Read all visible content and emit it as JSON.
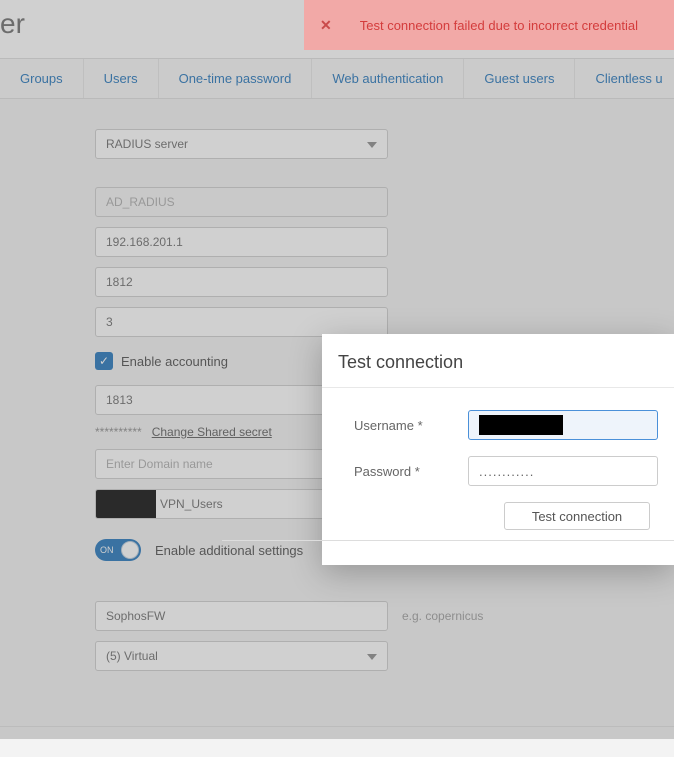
{
  "page_title_suffix": "er",
  "tabs": {
    "groups": "Groups",
    "users": "Users",
    "otp": "One-time password",
    "webauth": "Web authentication",
    "guest": "Guest users",
    "clientless": "Clientless u"
  },
  "form": {
    "server_type": "RADIUS server",
    "server_name": "AD_RADIUS",
    "ip": "192.168.201.1",
    "auth_port": "1812",
    "timeout": "3",
    "enable_accounting_label": "Enable accounting",
    "accounting_port": "1813",
    "secret_mask": "**********",
    "change_secret_link": "Change Shared secret",
    "domain_placeholder": "Enter Domain name",
    "group_suffix": "VPN_Users",
    "toggle_on": "ON",
    "additional_settings_label": "Enable additional settings",
    "nas_id": "SophosFW",
    "nas_hint": "e.g. copernicus",
    "nas_port_type": "(5) Virtual"
  },
  "error": {
    "close_glyph": "✕",
    "message": "Test connection failed due to incorrect credential"
  },
  "modal": {
    "title": "Test connection",
    "username_label": "Username *",
    "password_label": "Password *",
    "password_value": "............",
    "button_label": "Test connection"
  }
}
